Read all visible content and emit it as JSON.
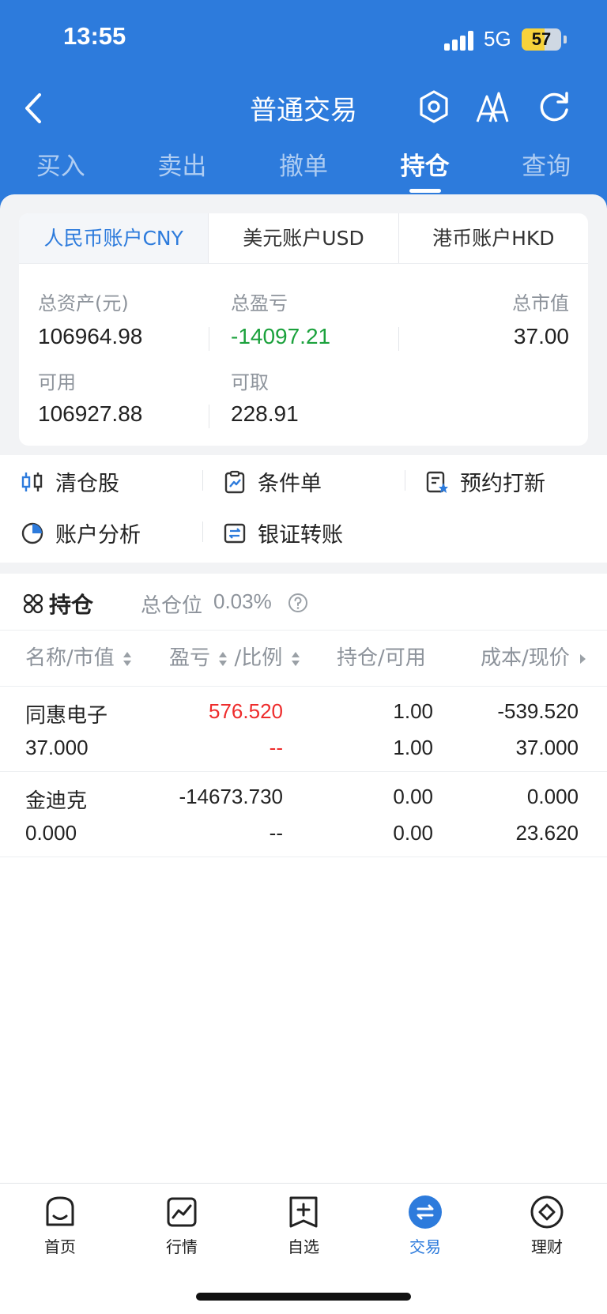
{
  "status": {
    "time": "13:55",
    "network": "5G",
    "battery": "57",
    "battery_level": 0.57
  },
  "header": {
    "title": "普通交易",
    "icons": [
      "back-icon",
      "settings-hex-icon",
      "font-size-icon",
      "refresh-icon"
    ],
    "tabs": [
      {
        "label": "买入"
      },
      {
        "label": "卖出"
      },
      {
        "label": "撤单"
      },
      {
        "label": "持仓"
      },
      {
        "label": "查询"
      }
    ],
    "active_tab": "持仓"
  },
  "account": {
    "tabs": [
      "人民币账户CNY",
      "美元账户USD",
      "港币账户HKD"
    ],
    "active_tab": "人民币账户CNY",
    "total_assets_label": "总资产(元)",
    "total_assets": "106964.98",
    "total_pnl_label": "总盈亏",
    "total_pnl": "-14097.21",
    "total_market_value_label": "总市值",
    "total_market_value": "37.00",
    "available_label": "可用",
    "available": "106927.88",
    "withdrawable_label": "可取",
    "withdrawable": "228.91"
  },
  "quick_actions": [
    {
      "label": "清仓股",
      "icon": "clear-stock-icon"
    },
    {
      "label": "条件单",
      "icon": "condition-order-icon"
    },
    {
      "label": "预约打新",
      "icon": "ipo-subscribe-icon"
    },
    {
      "label": "账户分析",
      "icon": "pie-chart-icon"
    },
    {
      "label": "银证转账",
      "icon": "transfer-icon"
    }
  ],
  "positions": {
    "title": "持仓",
    "ratio_label": "总仓位",
    "ratio_value": "0.03%",
    "columns": [
      "名称/市值",
      "盈亏",
      "/比例",
      "持仓/可用",
      "成本/现价"
    ],
    "rows": [
      {
        "name": "同惠电子",
        "market_value": "37.000",
        "pnl": "576.520",
        "pnl_ratio": "--",
        "holding": "1.00",
        "available": "1.00",
        "cost": "-539.520",
        "price": "37.000"
      },
      {
        "name": "金迪克",
        "market_value": "0.000",
        "pnl": "-14673.730",
        "pnl_ratio": "--",
        "holding": "0.00",
        "available": "0.00",
        "cost": "0.000",
        "price": "23.620"
      }
    ]
  },
  "colors": {
    "brand_blue": "#2d7bdc",
    "gain_red": "#ee2c2c",
    "loss_green": "#1ba13c"
  },
  "bottom_nav": [
    {
      "label": "首页",
      "icon": "home-icon"
    },
    {
      "label": "行情",
      "icon": "market-icon"
    },
    {
      "label": "自选",
      "icon": "watchlist-icon"
    },
    {
      "label": "交易",
      "icon": "trade-icon"
    },
    {
      "label": "理财",
      "icon": "wealth-icon"
    }
  ],
  "active_nav": "交易"
}
